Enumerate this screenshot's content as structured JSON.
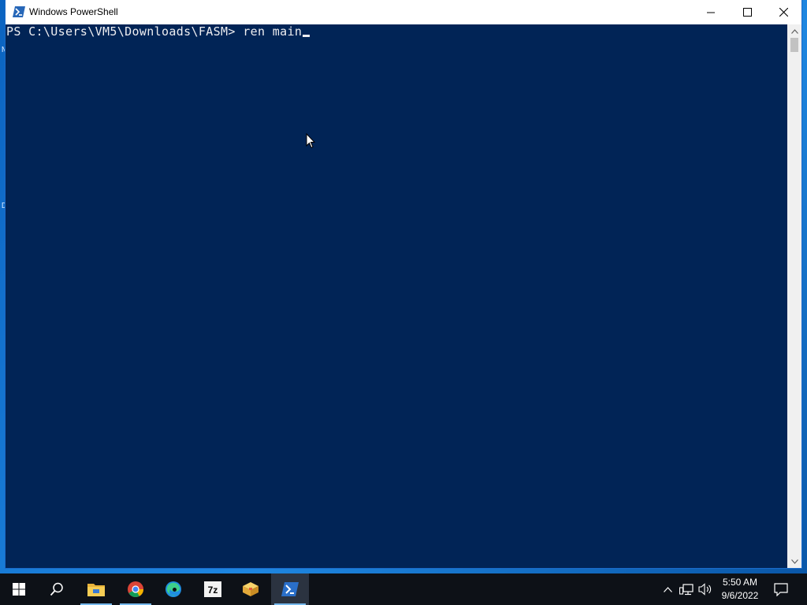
{
  "window": {
    "title": "Windows PowerShell"
  },
  "console": {
    "prompt": "PS C:\\Users\\VM5\\Downloads\\FASM> ",
    "command": "ren main"
  },
  "desktop": {
    "hints": [
      "N",
      "D"
    ]
  },
  "taskbar": {
    "apps": [
      "start",
      "search",
      "file-explorer",
      "chrome",
      "edge",
      "7zip",
      "archive",
      "powershell"
    ],
    "active_app": "powershell"
  },
  "clock": {
    "time": "5:50 AM",
    "date": "9/6/2022"
  },
  "colors": {
    "console_bg": "#012456",
    "console_fg": "#eeedf0",
    "taskbar_bg": "#0d1117",
    "accent": "#76b9ed"
  }
}
